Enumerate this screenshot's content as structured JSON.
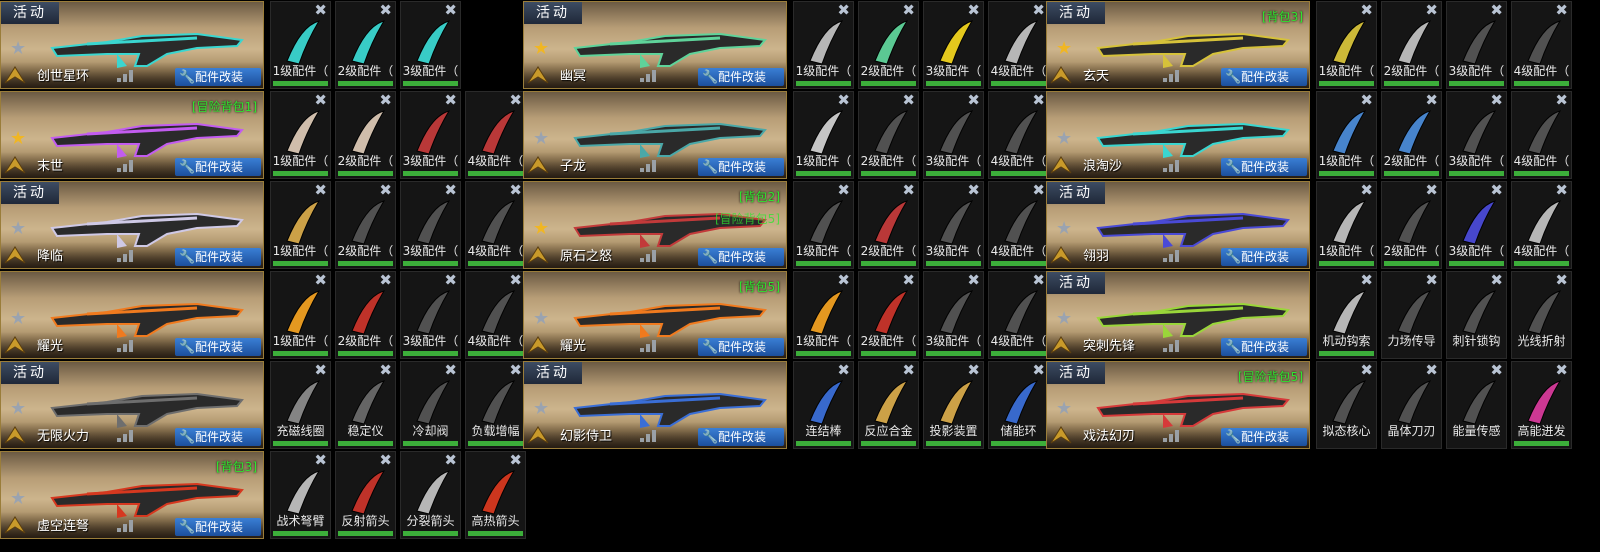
{
  "ui": {
    "event_label": "活动",
    "mod_label": "配件改装",
    "close_glyph": "✖",
    "star_glyph": "★",
    "wrench_glyph": "🔧",
    "colors": {
      "tag": "#2ee62e",
      "mod_button": "#2a67bd",
      "progress": "#3cae3a",
      "star_gold": "#f0b623",
      "star_grey": "#9aa3b0"
    }
  },
  "columns": [
    {
      "rows": [
        {
          "weapon": "创世星环",
          "event": true,
          "star": "grey",
          "tag": "",
          "tag2": "",
          "gun_color": "#3ad6d0",
          "parts": [
            {
              "label": "1级配件（",
              "icon": "blade-part-icon",
              "color": "#3ad6d0",
              "done": true
            },
            {
              "label": "2级配件（",
              "icon": "claw-part-icon",
              "color": "#3ad6d0",
              "done": true
            },
            {
              "label": "3级配件（",
              "icon": "crescent-part-icon",
              "color": "#3ad6d0",
              "done": true
            }
          ]
        },
        {
          "weapon": "末世",
          "event": false,
          "star": "gold",
          "tag": "[冒险背包1]",
          "tag2": "",
          "gun_color": "#c25cf0",
          "parts": [
            {
              "label": "1级配件（",
              "icon": "jaw-part-icon",
              "color": "#d9c7b4",
              "done": true
            },
            {
              "label": "2级配件（",
              "icon": "talon-part-icon",
              "color": "#d9c7b4",
              "done": true
            },
            {
              "label": "3级配件（",
              "icon": "wing-part-icon",
              "color": "#c23a3a",
              "done": true
            },
            {
              "label": "4级配件（",
              "icon": "spike-part-icon",
              "color": "#c23a3a",
              "done": true
            }
          ]
        },
        {
          "weapon": "降临",
          "event": true,
          "star": "grey",
          "tag": "",
          "tag2": "",
          "gun_color": "#cfc9e6",
          "parts": [
            {
              "label": "1级配件（",
              "icon": "plate-part-icon",
              "color": "#d6a94a",
              "done": true
            },
            {
              "label": "2级配件（",
              "icon": "grip-part-icon",
              "color": "#555555",
              "done": true
            },
            {
              "label": "3级配件（",
              "icon": "barrel-part-icon",
              "color": "#555555",
              "done": true
            },
            {
              "label": "4级配件（",
              "icon": "frame-part-icon",
              "color": "#555555",
              "done": true
            }
          ]
        },
        {
          "weapon": "耀光",
          "event": false,
          "star": "grey",
          "tag": "",
          "tag2": "",
          "gun_color": "#f07a1e",
          "parts": [
            {
              "label": "1级配件（",
              "icon": "flare-part-icon",
              "color": "#f0a021",
              "done": true
            },
            {
              "label": "2级配件（",
              "icon": "core-part-icon",
              "color": "#c9342b",
              "done": true
            },
            {
              "label": "3级配件（",
              "icon": "fin-part-icon",
              "color": "#555555",
              "done": true
            },
            {
              "label": "4级配件（",
              "icon": "hook-part-icon",
              "color": "#555555",
              "done": true
            }
          ]
        },
        {
          "weapon": "无限火力",
          "event": true,
          "star": "grey",
          "tag": "",
          "tag2": "",
          "gun_color": "#6e6e6e",
          "parts": [
            {
              "label": "充磁线圈",
              "icon": "coil-part-icon",
              "color": "#8a8a8a",
              "done": true
            },
            {
              "label": "稳定仪",
              "icon": "stabilizer-part-icon",
              "color": "#6a6a6a",
              "done": true
            },
            {
              "label": "冷却阀",
              "icon": "valve-part-icon",
              "color": "#555555",
              "done": true
            },
            {
              "label": "负载增幅",
              "icon": "booster-part-icon",
              "color": "#555555",
              "done": true
            }
          ]
        },
        {
          "weapon": "虚空连弩",
          "event": false,
          "star": "grey",
          "tag": "[背包3]",
          "tag2": "",
          "gun_color": "#d6381f",
          "parts": [
            {
              "label": "战术弩臂",
              "icon": "bow-arm-part-icon",
              "color": "#bfbfbf",
              "done": true
            },
            {
              "label": "反射箭头",
              "icon": "arrowhead-part-icon",
              "color": "#c9342b",
              "done": true
            },
            {
              "label": "分裂箭头",
              "icon": "split-arrow-part-icon",
              "color": "#bfbfbf",
              "done": true
            },
            {
              "label": "高热箭头",
              "icon": "heat-arrow-part-icon",
              "color": "#d6381f",
              "done": true
            }
          ]
        }
      ]
    },
    {
      "rows": [
        {
          "weapon": "幽冥",
          "event": true,
          "star": "gold",
          "tag": "",
          "tag2": "",
          "gun_color": "#5fd39a",
          "parts": [
            {
              "label": "1级配件（",
              "icon": "arc-part-icon",
              "color": "#bfbfbf",
              "done": true
            },
            {
              "label": "2级配件（",
              "icon": "crest-part-icon",
              "color": "#5fd39a",
              "done": true
            },
            {
              "label": "3级配件（",
              "icon": "ring-part-icon",
              "color": "#f0d21e",
              "done": true
            },
            {
              "label": "4级配件（",
              "icon": "moon-part-icon",
              "color": "#bfbfbf",
              "done": true
            }
          ]
        },
        {
          "weapon": "子龙",
          "event": false,
          "star": "grey",
          "tag": "",
          "tag2": "",
          "gun_color": "#4aa8a8",
          "parts": [
            {
              "label": "1级配件（",
              "icon": "dragon-part-icon",
              "color": "#cfcfcf",
              "done": true
            },
            {
              "label": "2级配件（",
              "icon": "scale-part-icon",
              "color": "#555555",
              "done": true
            },
            {
              "label": "3级配件（",
              "icon": "curl-part-icon",
              "color": "#555555",
              "done": true
            },
            {
              "label": "4级配件（",
              "icon": "rod-part-icon",
              "color": "#555555",
              "done": true
            }
          ]
        },
        {
          "weapon": "原石之怒",
          "event": false,
          "star": "gold",
          "tag": "[背包2]",
          "tag2": "[冒险背包5]",
          "gun_color": "#c23a3a",
          "parts": [
            {
              "label": "1级配件（",
              "icon": "shard-part-icon",
              "color": "#555555",
              "done": true
            },
            {
              "label": "2级配件（",
              "icon": "rune-part-icon",
              "color": "#c23a3a",
              "done": true
            },
            {
              "label": "3级配件（",
              "icon": "block-part-icon",
              "color": "#555555",
              "done": true
            },
            {
              "label": "4级配件（",
              "icon": "edge-part-icon",
              "color": "#555555",
              "done": true
            }
          ]
        },
        {
          "weapon": "耀光",
          "event": false,
          "star": "grey",
          "tag": "[背包5]",
          "tag2": "",
          "gun_color": "#f07a1e",
          "parts": [
            {
              "label": "1级配件（",
              "icon": "flare-part-icon",
              "color": "#f0a021",
              "done": true
            },
            {
              "label": "2级配件（",
              "icon": "core-part-icon",
              "color": "#c9342b",
              "done": true
            },
            {
              "label": "3级配件（",
              "icon": "fin-part-icon",
              "color": "#555555",
              "done": true
            },
            {
              "label": "4级配件（",
              "icon": "hook-part-icon",
              "color": "#555555",
              "done": true
            }
          ]
        },
        {
          "weapon": "幻影侍卫",
          "event": true,
          "star": "grey",
          "tag": "",
          "tag2": "",
          "gun_color": "#3a6ed6",
          "parts": [
            {
              "label": "连结棒",
              "icon": "link-rod-part-icon",
              "color": "#3a6ed6",
              "done": true
            },
            {
              "label": "反应合金",
              "icon": "alloy-part-icon",
              "color": "#d6a94a",
              "done": true
            },
            {
              "label": "投影装置",
              "icon": "projector-part-icon",
              "color": "#d6a94a",
              "done": true
            },
            {
              "label": "储能环",
              "icon": "energy-ring-part-icon",
              "color": "#3a6ed6",
              "done": true
            }
          ]
        }
      ]
    },
    {
      "rows": [
        {
          "weapon": "玄天",
          "event": true,
          "star": "gold",
          "tag": "[背包3]",
          "tag2": "",
          "gun_color": "#d6c23a",
          "parts": [
            {
              "label": "1级配件（",
              "icon": "spire-part-icon",
              "color": "#d6c23a",
              "done": true
            },
            {
              "label": "2级配件（",
              "icon": "pillar-part-icon",
              "color": "#bfbfbf",
              "done": true
            },
            {
              "label": "3级配件（",
              "icon": "twist-part-icon",
              "color": "#555555",
              "done": true
            },
            {
              "label": "4级配件（",
              "icon": "shell-part-icon",
              "color": "#555555",
              "done": true
            }
          ]
        },
        {
          "weapon": "浪淘沙",
          "event": false,
          "star": "grey",
          "tag": "",
          "tag2": "",
          "gun_color": "#3ad6d0",
          "parts": [
            {
              "label": "1级配件（",
              "icon": "wave-part-icon",
              "color": "#4a8ad6",
              "done": true
            },
            {
              "label": "2级配件（",
              "icon": "vortex-part-icon",
              "color": "#4a8ad6",
              "done": true
            },
            {
              "label": "3级配件（",
              "icon": "blade-grey-part-icon",
              "color": "#555555",
              "done": true
            },
            {
              "label": "4级配件（",
              "icon": "hook-grey-part-icon",
              "color": "#555555",
              "done": true
            }
          ]
        },
        {
          "weapon": "翎羽",
          "event": true,
          "star": "grey",
          "tag": "",
          "tag2": "",
          "gun_color": "#4a4ad6",
          "parts": [
            {
              "label": "1级配件（",
              "icon": "feather-part-icon",
              "color": "#bfbfbf",
              "done": true
            },
            {
              "label": "2级配件（",
              "icon": "sickle-part-icon",
              "color": "#555555",
              "done": true
            },
            {
              "label": "3级配件（",
              "icon": "plume-part-icon",
              "color": "#4a4ad6",
              "done": true
            },
            {
              "label": "4级配件（",
              "icon": "quill-part-icon",
              "color": "#bfbfbf",
              "done": true
            }
          ]
        },
        {
          "weapon": "突刺先锋",
          "event": true,
          "star": "grey",
          "tag": "",
          "tag2": "",
          "gun_color": "#9ad63a",
          "parts": [
            {
              "label": "机动钩索",
              "icon": "grapple-part-icon",
              "color": "#bfbfbf",
              "done": true
            },
            {
              "label": "力场传导",
              "icon": "field-part-icon",
              "color": "#555555",
              "done": false
            },
            {
              "label": "刺针锁钩",
              "icon": "needle-part-icon",
              "color": "#555555",
              "done": false
            },
            {
              "label": "光线折射",
              "icon": "refract-part-icon",
              "color": "#555555",
              "done": false
            }
          ]
        },
        {
          "weapon": "戏法幻刃",
          "event": true,
          "star": "grey",
          "tag": "[冒险背包5]",
          "tag2": "",
          "gun_color": "#d63a3a",
          "parts": [
            {
              "label": "拟态核心",
              "icon": "mimic-core-part-icon",
              "color": "#555555",
              "done": false
            },
            {
              "label": "晶体刀刃",
              "icon": "crystal-blade-part-icon",
              "color": "#555555",
              "done": false
            },
            {
              "label": "能量传感",
              "icon": "sensor-part-icon",
              "color": "#555555",
              "done": false
            },
            {
              "label": "高能迸发",
              "icon": "burst-part-icon",
              "color": "#d63a9a",
              "done": true
            }
          ]
        }
      ]
    }
  ]
}
